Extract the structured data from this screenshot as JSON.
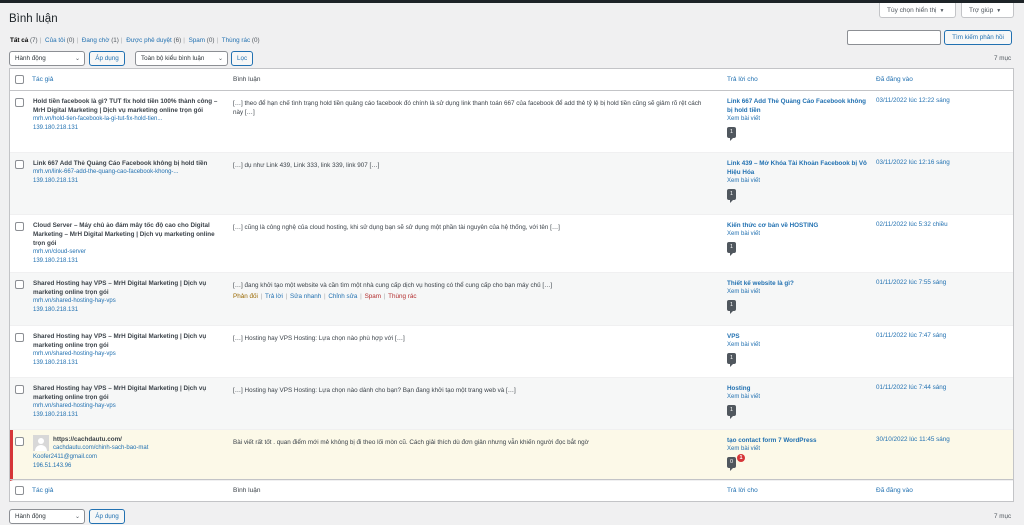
{
  "header": {
    "title": "Bình luận",
    "screen_options": "Tùy chọn hiển thị",
    "help": "Trợ giúp"
  },
  "filters": [
    {
      "label": "Tất cả",
      "count": "(7)",
      "current": true
    },
    {
      "label": "Của tôi",
      "count": "(0)"
    },
    {
      "label": "Đang chờ",
      "count": "(1)"
    },
    {
      "label": "Được phê duyệt",
      "count": "(6)"
    },
    {
      "label": "Spam",
      "count": "(0)"
    },
    {
      "label": "Thùng rác",
      "count": "(0)"
    }
  ],
  "search": {
    "placeholder": "",
    "button": "Tìm kiếm phản hồi"
  },
  "toolbar": {
    "bulk_action": "Hành động",
    "apply": "Áp dụng",
    "comment_type": "Toàn bộ kiểu bình luận",
    "filter": "Lọc",
    "count": "7 mục"
  },
  "columns": {
    "author": "Tác giả",
    "comment": "Bình luận",
    "response": "Trả lời cho",
    "date": "Đã đăng vào"
  },
  "rows": [
    {
      "author_name": "Hold tiền facebook là gì? TUT fix hold tiền 100% thành công – MrH Digital Marketing | Dịch vụ marketing online trọn gói",
      "author_url": "mrh.vn/hold-tien-facebook-la-gi-tut-fix-hold-tien...",
      "author_ip": "139.180.218.131",
      "comment": "[…] theo để hạn chế tình trạng hold tiền quảng cáo facebook đó chính là sử dụng link thanh toán 667 của facebook để add thẻ tỷ lệ bị hold tiền cũng sẽ giảm rõ rệt cách này […]",
      "response_title": "Link 667 Add Thẻ Quảng Cáo Facebook không bị hold tiền",
      "view_post": "Xem bài viết",
      "bubble": "1",
      "date": "03/11/2022 lúc 12:22 sáng"
    },
    {
      "author_name": "Link 667 Add Thẻ Quảng Cáo Facebook không bị hold tiền",
      "author_url": "mrh.vn/link-667-add-the-quang-cao-facebook-khong-...",
      "author_ip": "139.180.218.131",
      "comment": "[…] dụ như Link 439, Link 333, link 339, link 907 […]",
      "response_title": "Link 439 – Mở Khóa Tài Khoản Facebook bị Vô Hiệu Hóa",
      "view_post": "Xem bài viết",
      "bubble": "1",
      "date": "03/11/2022 lúc 12:16 sáng"
    },
    {
      "author_name": "Cloud Server – Máy chủ ảo đám mây tốc độ cao cho Digital Marketing – MrH Digital Marketing | Dịch vụ marketing online trọn gói",
      "author_url": "mrh.vn/cloud-server",
      "author_ip": "139.180.218.131",
      "comment": "[…] cũng là công nghệ của cloud hosting, khi sử dụng bạn sẽ sử dụng một phần tài nguyên của hệ thống, với tên […]",
      "response_title": "Kiến thức cơ bản về HOSTING",
      "view_post": "Xem bài viết",
      "bubble": "1",
      "date": "02/11/2022 lúc 5:32 chiều"
    },
    {
      "author_name": "Shared Hosting hay VPS – MrH Digital Marketing | Dịch vụ marketing online trọn gói",
      "author_url": "mrh.vn/shared-hosting-hay-vps",
      "author_ip": "139.180.218.131",
      "comment": "[…] đang khởi tạo một website và cần tìm một nhà cung cấp dịch vụ hosting có thể cung cấp cho bạn máy chủ […]",
      "actions": [
        "Phản đối",
        "Trả lời",
        "Sửa nhanh",
        "Chỉnh sửa",
        "Spam",
        "Thùng rác"
      ],
      "response_title": "Thiết kế website là gì?",
      "view_post": "Xem bài viết",
      "bubble": "1",
      "date": "01/11/2022 lúc 7:55 sáng"
    },
    {
      "author_name": "Shared Hosting hay VPS – MrH Digital Marketing | Dịch vụ marketing online trọn gói",
      "author_url": "mrh.vn/shared-hosting-hay-vps",
      "author_ip": "139.180.218.131",
      "comment": "[…] Hosting hay VPS Hosting: Lựa chọn nào phù hợp với […]",
      "response_title": "VPS",
      "view_post": "Xem bài viết",
      "bubble": "1",
      "date": "01/11/2022 lúc 7:47 sáng"
    },
    {
      "author_name": "Shared Hosting hay VPS – MrH Digital Marketing | Dịch vụ marketing online trọn gói",
      "author_url": "mrh.vn/shared-hosting-hay-vps",
      "author_ip": "139.180.218.131",
      "comment": "[…] Hosting hay VPS Hosting: Lựa chọn nào dành cho bạn? Bạn đang khởi tạo một trang web và […]",
      "response_title": "Hosting",
      "view_post": "Xem bài viết",
      "bubble": "1",
      "date": "01/11/2022 lúc 7:44 sáng"
    },
    {
      "author_name": "https://cachdautu.com/",
      "author_url": "cachdautu.com/chinh-sach-bao-mat",
      "author_email": "Koofer2411@gmail.com",
      "author_ip": "196.51.143.96",
      "comment": "Bài viết rất tốt . quan điểm mới mẻ không bị đi theo lối mòn cũ. Cách giải thích dù đơn giản nhưng vẫn khiến người đọc bắt ngờ",
      "response_title": "tạo contact form 7 WordPress",
      "view_post": "Xem bài viết",
      "bubble": "0",
      "pending_badge": "1",
      "date": "30/10/2022 lúc 11:45 sáng"
    }
  ]
}
